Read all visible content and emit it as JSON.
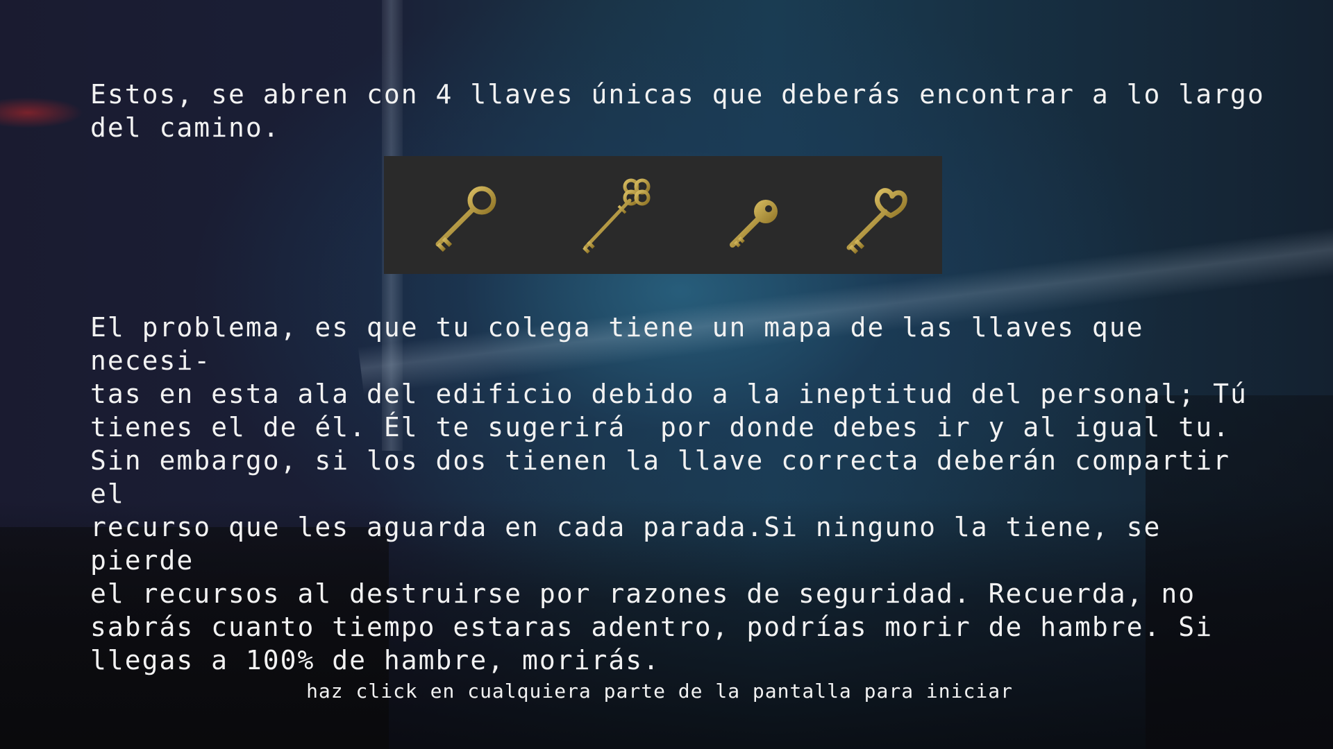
{
  "intro_text": "Estos, se abren con 4 llaves únicas que deberás encontrar a lo largo\ndel camino.",
  "keys": [
    {
      "icon": "key-round-icon"
    },
    {
      "icon": "key-ornate-icon"
    },
    {
      "icon": "key-small-icon"
    },
    {
      "icon": "key-heart-icon"
    }
  ],
  "key_color": "#b99c3f",
  "problem_text": "El problema, es que tu colega tiene un mapa de las llaves que necesi-\ntas en esta ala del edificio debido a la ineptitud del personal; Tú\ntienes el de él. Él te sugerirá  por donde debes ir y al igual tu.\nSin embargo, si los dos tienen la llave correcta deberán compartir el\nrecurso que les aguarda en cada parada.Si ninguno la tiene, se pierde\nel recursos al destruirse por razones de seguridad. Recuerda, no\nsabrás cuanto tiempo estaras adentro, podrías morir de hambre. Si\nllegas a 100% de hambre, morirás.",
  "start_hint": "haz click en cualquiera parte de la pantalla para iniciar"
}
